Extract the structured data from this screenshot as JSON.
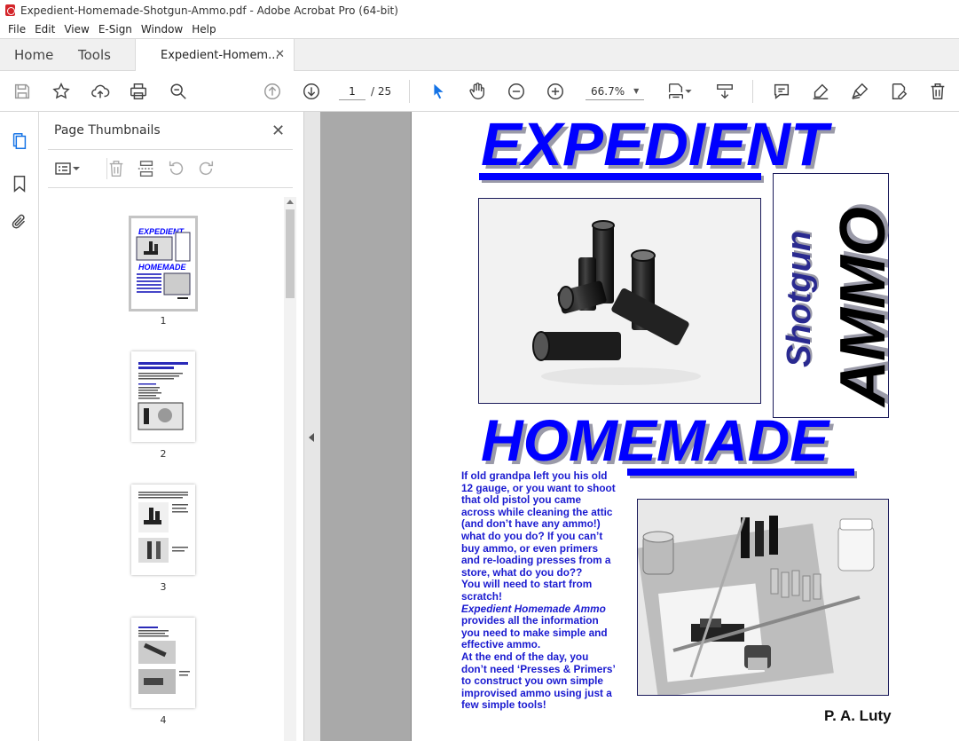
{
  "window": {
    "title": "Expedient-Homemade-Shotgun-Ammo.pdf - Adobe Acrobat Pro (64-bit)"
  },
  "menu": [
    "File",
    "Edit",
    "View",
    "E-Sign",
    "Window",
    "Help"
  ],
  "tabs": {
    "home": "Home",
    "tools": "Tools",
    "doc": "Expedient-Homem..."
  },
  "toolbar": {
    "page_current": "1",
    "page_total": "/ 25",
    "zoom": "66.7%"
  },
  "panel": {
    "title": "Page Thumbnails",
    "thumbs": [
      "1",
      "2",
      "3",
      "4"
    ]
  },
  "cover": {
    "title_top": "EXPEDIENT",
    "title_bottom": "HOMEMADE",
    "side_small": "Shotgun",
    "side_big": "AMMO",
    "blurb": [
      "If old grandpa left you his old",
      "12 gauge, or you want to shoot",
      "that old pistol you came",
      "across while cleaning the attic",
      "(and don’t have any ammo!)",
      "what do you do? If you can’t",
      "buy ammo, or even primers",
      "and re-loading presses from a",
      "store, what do you do??",
      "You will need to start from",
      "scratch!",
      "Expedient Homemade Ammo",
      "provides all the information",
      "you need to make simple and",
      "effective ammo.",
      "At the end of the day, you",
      "don’t need ‘Presses & Primers’",
      "to construct you own simple",
      "improvised ammo using just a",
      "few simple tools!"
    ],
    "author": "P. A. Luty"
  },
  "colors": {
    "accent_blue": "#0000ff",
    "acrobat_red": "#d4252a"
  }
}
